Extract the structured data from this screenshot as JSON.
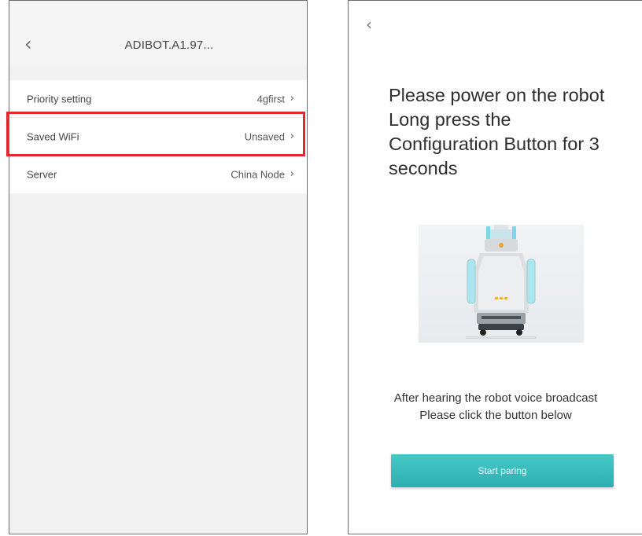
{
  "left_screen": {
    "title": "ADIBOT.A1.97...",
    "back_icon": "chevron-left-icon",
    "settings": [
      {
        "label": "Priority setting",
        "value": "4gfirst"
      },
      {
        "label": "Saved WiFi",
        "value": "Unsaved"
      },
      {
        "label": "Server",
        "value": "China Node"
      }
    ],
    "highlight_color": "#e3272e"
  },
  "right_screen": {
    "back_icon": "chevron-left-icon",
    "instruction_lines": [
      "Please power on the robot",
      "Long press the",
      "Configuration Button for 3",
      "seconds"
    ],
    "after_lines": [
      "After hearing the robot voice broadcast",
      "Please click the button below"
    ],
    "start_button_label": "Start paring",
    "accent_color": "#3bbdbd"
  }
}
